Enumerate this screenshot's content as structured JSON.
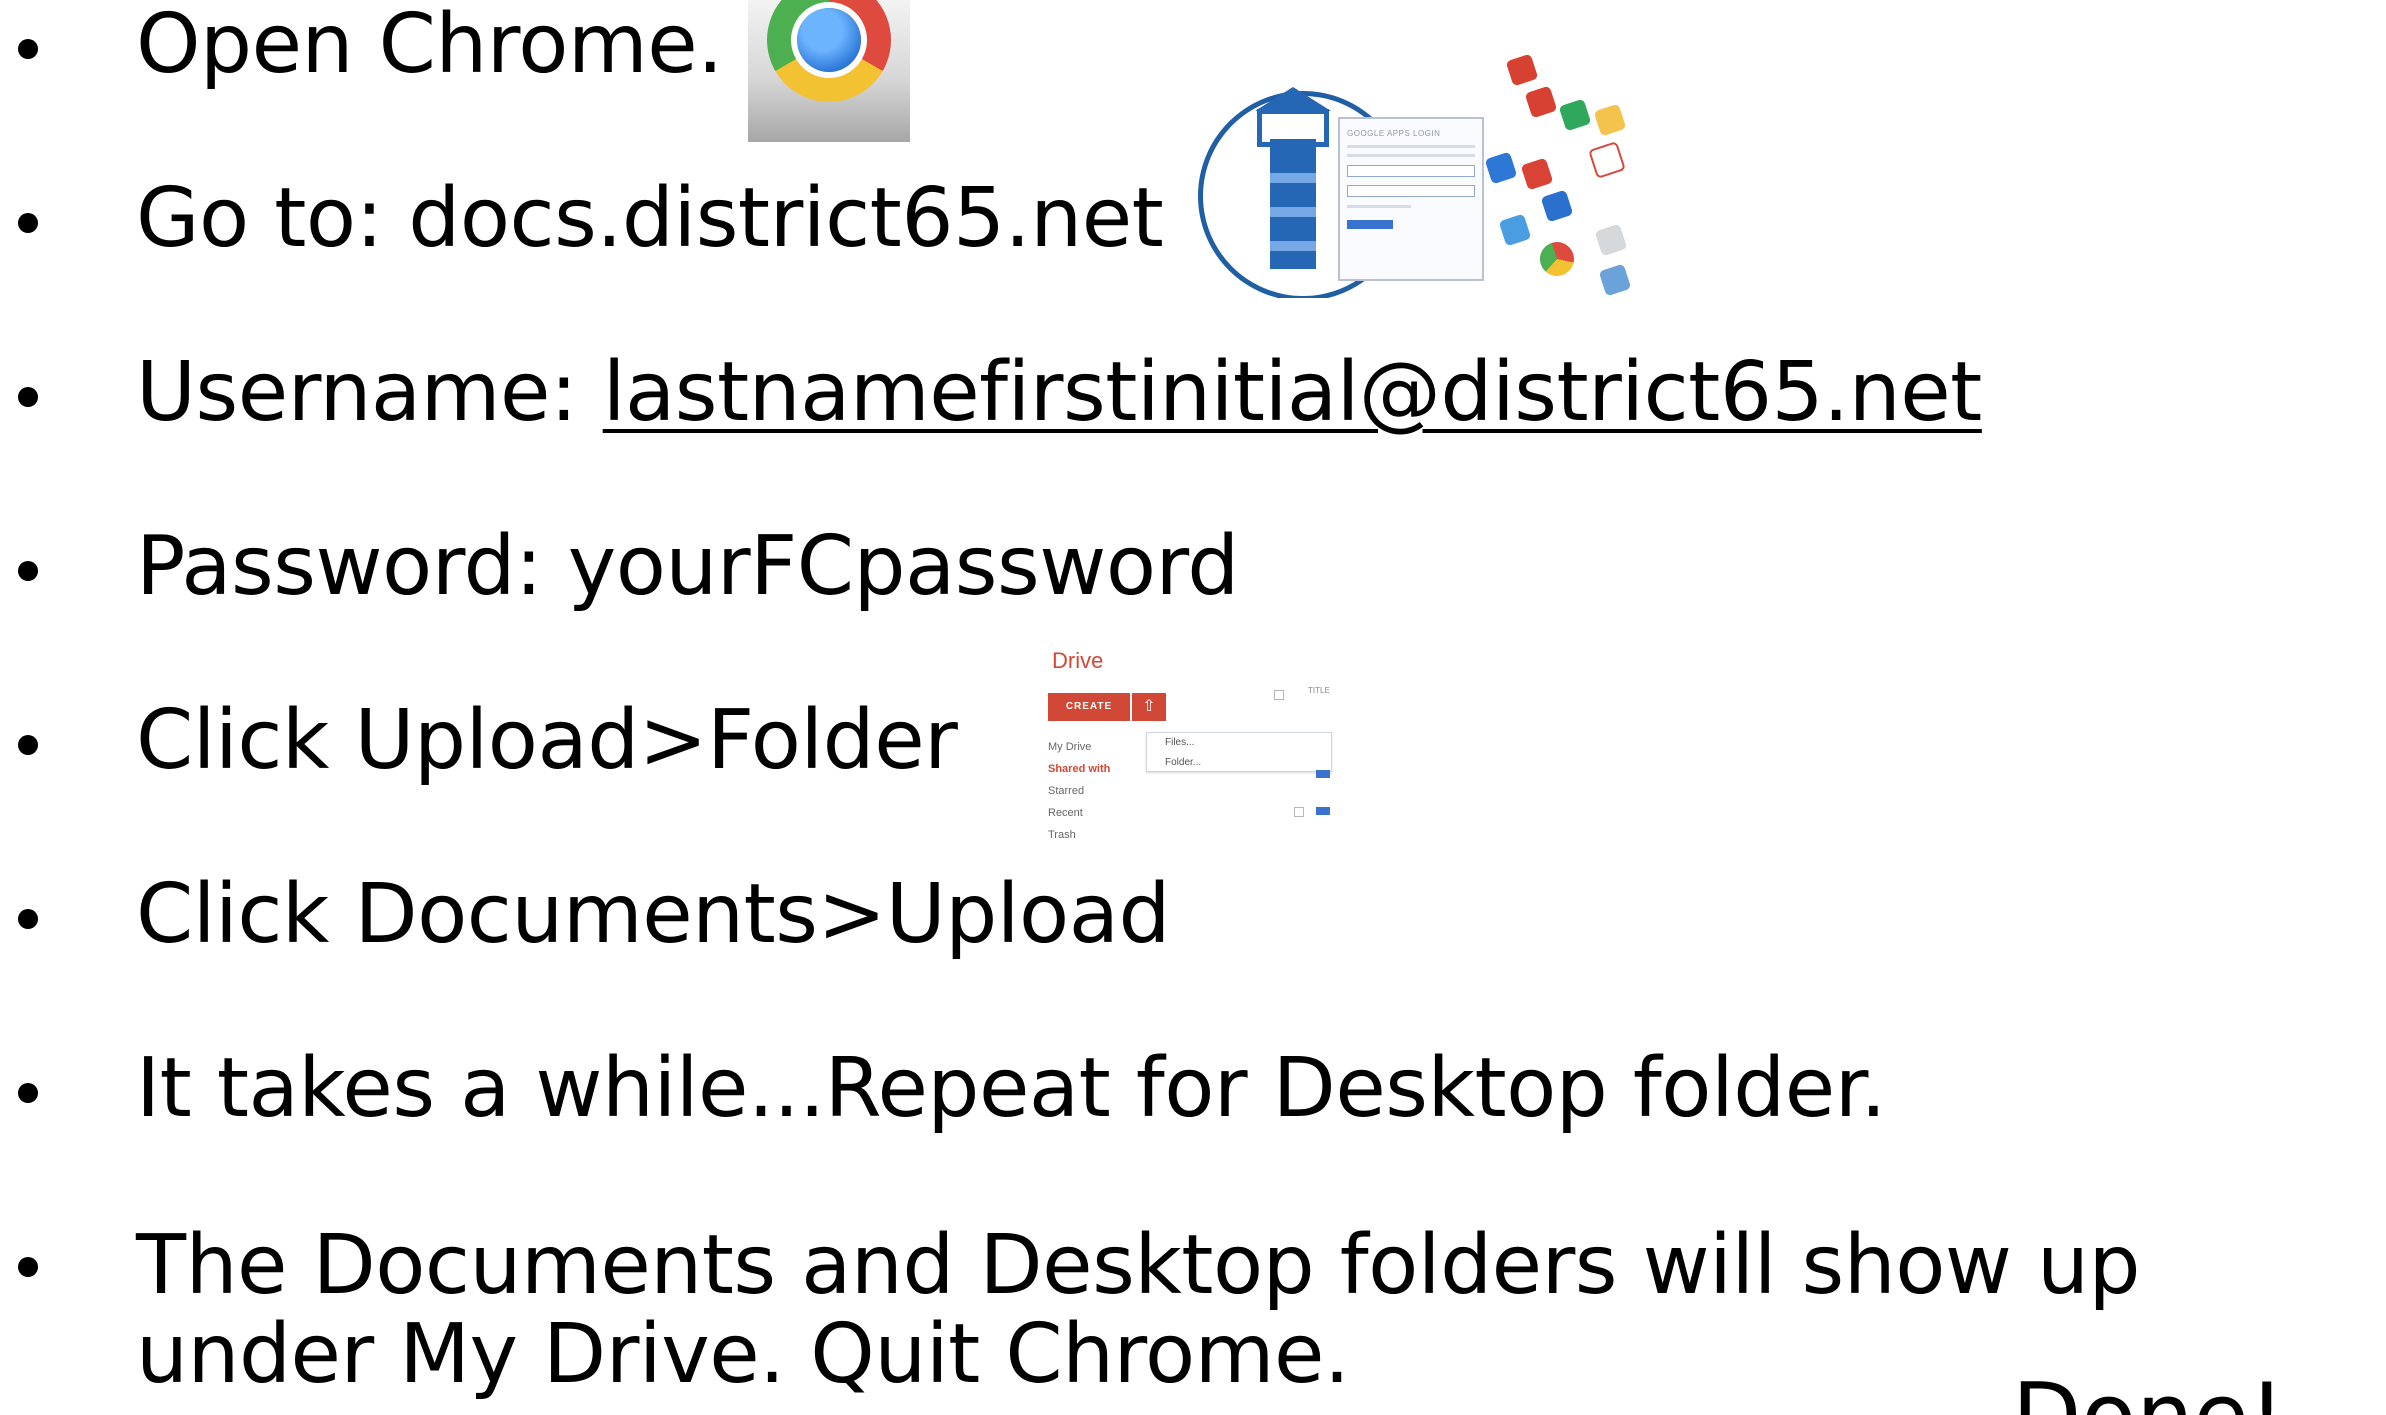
{
  "slide": {
    "items": [
      {
        "text": "Open Chrome."
      },
      {
        "text": "Go to: docs.district65.net"
      },
      {
        "label": "Username: ",
        "link": "lastnamefirstinitial@district65.net"
      },
      {
        "text": "Password: yourFCpassword"
      },
      {
        "text": "Click Upload>Folder"
      },
      {
        "text": "Click Documents>Upload"
      },
      {
        "text": "It takes a while...Repeat for Desktop folder."
      },
      {
        "text": "The Documents and Desktop folders will show up under My Drive. Quit Chrome."
      }
    ],
    "corner_text": "Done!"
  },
  "thumbnails": {
    "chrome_icon": "chrome-icon",
    "apps_login": {
      "icon": "google-apps-login-icon",
      "title": "GOOGLE APPS LOGIN"
    },
    "drive": {
      "icon": "drive-upload-menu-icon",
      "title": "Drive",
      "create_label": "CREATE",
      "sidebar": [
        "My Drive",
        "Shared with",
        "Starred",
        "Recent",
        "Trash"
      ],
      "menu": [
        "Files...",
        "Folder..."
      ],
      "column_title": "TITLE"
    }
  },
  "colors": {
    "text": "#000000",
    "background": "#ffffff",
    "accent_blue": "#215fa5",
    "drive_red": "#d14836"
  }
}
